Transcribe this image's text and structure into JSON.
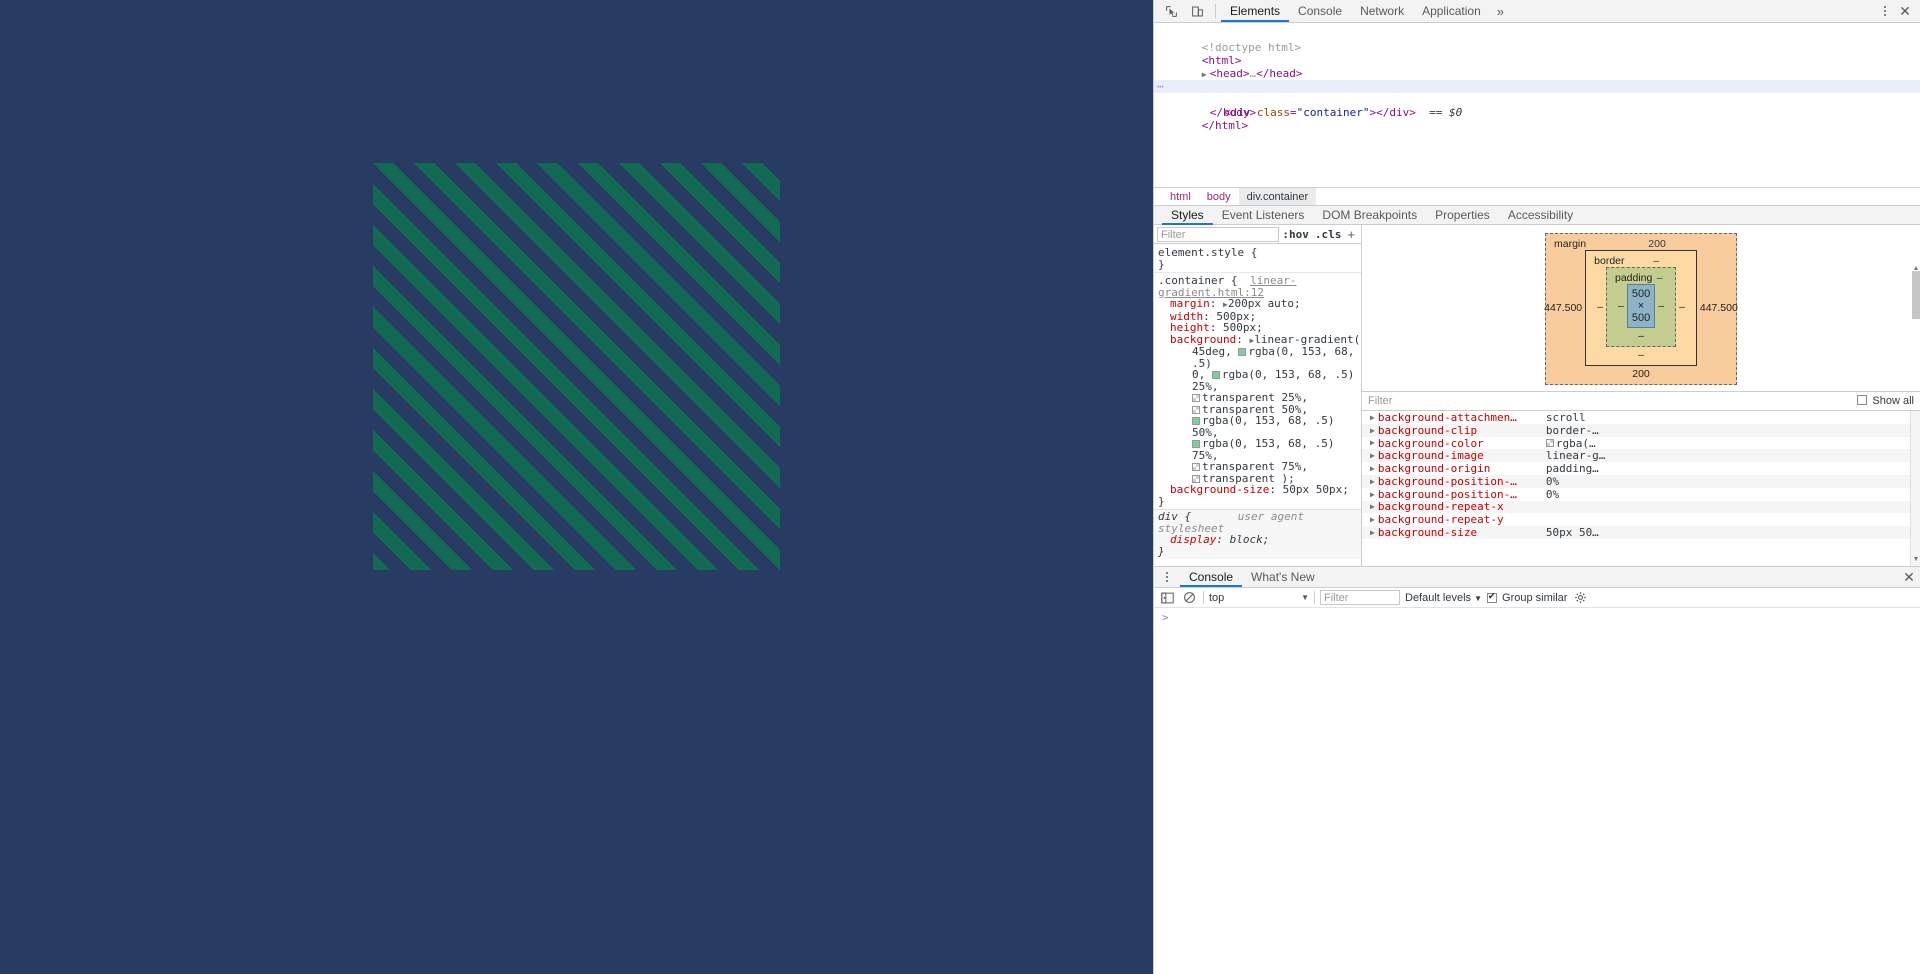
{
  "page": {
    "background_color": "#273b63",
    "box": {
      "name": "container-striped-box",
      "stripe_color": "rgba(0, 153, 68, .5)",
      "angle": "45deg",
      "tile": "50px 50px",
      "size": "500 x 500"
    }
  },
  "devtools": {
    "toolbar": {
      "inspect_icon": "inspect-cursor-icon",
      "device_icon": "device-toolbar-icon",
      "tabs": [
        {
          "label": "Elements",
          "active": true
        },
        {
          "label": "Console",
          "active": false
        },
        {
          "label": "Network",
          "active": false
        },
        {
          "label": "Application",
          "active": false
        }
      ],
      "more_tabs": "»",
      "menu_icon": "kebab-menu-icon",
      "close_icon": "close-icon"
    },
    "dom": {
      "lines": [
        {
          "indent": 0,
          "tokens": [
            {
              "t": "cmt",
              "v": "<!doctype html>"
            }
          ]
        },
        {
          "indent": 0,
          "tokens": [
            {
              "t": "tg",
              "v": "<html>"
            }
          ]
        },
        {
          "indent": 0,
          "caret": "▶",
          "tokens": [
            {
              "t": "tg",
              "v": "<head>"
            },
            {
              "t": "cmt",
              "v": "…"
            },
            {
              "t": "tg",
              "v": "</head>"
            }
          ]
        },
        {
          "indent": 0,
          "caret": "▼",
          "tokens": [
            {
              "t": "tg",
              "v": "<body>"
            }
          ]
        },
        {
          "indent": 1,
          "selected": true,
          "ellipsis": "⋯",
          "tokens": [
            {
              "t": "tg",
              "v": "<div "
            },
            {
              "t": "attr",
              "v": "class"
            },
            {
              "t": "tg",
              "v": "="
            },
            {
              "t": "val",
              "v": "\"container\""
            },
            {
              "t": "tg",
              "v": "></div>"
            },
            {
              "t": "dollar",
              "v": "  == $0"
            }
          ]
        },
        {
          "indent": 0,
          "tokens": [
            {
              "t": "tg",
              "v": "</body>"
            }
          ]
        },
        {
          "indent": 0,
          "tokens": [
            {
              "t": "tg",
              "v": "</html>"
            }
          ]
        }
      ]
    },
    "breadcrumb": [
      {
        "label": "html",
        "selected": false
      },
      {
        "label": "body",
        "selected": false
      },
      {
        "label": "div.container",
        "selected": true
      }
    ],
    "sidebar_tabs": [
      {
        "label": "Styles",
        "active": true
      },
      {
        "label": "Event Listeners",
        "active": false
      },
      {
        "label": "DOM Breakpoints",
        "active": false
      },
      {
        "label": "Properties",
        "active": false
      },
      {
        "label": "Accessibility",
        "active": false
      }
    ],
    "styles": {
      "filter_placeholder": "Filter",
      "hov_label": ":hov",
      "cls_label": ".cls",
      "plus_label": "+",
      "rules": [
        {
          "selector": "element.style {",
          "origin": "",
          "declarations": [],
          "close": "}"
        },
        {
          "selector": ".container {",
          "origin": "linear-gradient.html:12",
          "declarations": [
            {
              "tri": true,
              "name": "margin",
              "value": "200px auto;"
            },
            {
              "tri": false,
              "name": "width",
              "value": "500px;"
            },
            {
              "tri": false,
              "name": "height",
              "value": "500px;"
            },
            {
              "tri": true,
              "name": "background",
              "value": "linear-gradient("
            },
            {
              "cont": true,
              "swatch": "green",
              "value": "45deg, ",
              "value2": "rgba(0, 153, 68, .5)"
            },
            {
              "cont": true,
              "swatch": "green",
              "value": "0, ",
              "value2": "rgba(0, 153, 68, .5) 25%,"
            },
            {
              "cont": true,
              "swatch": "trans",
              "value": "",
              "value2": "transparent 25%,"
            },
            {
              "cont": true,
              "swatch": "trans",
              "value": "",
              "value2": "transparent 50%,"
            },
            {
              "cont": true,
              "swatch": "green",
              "value": "",
              "value2": "rgba(0, 153, 68, .5) 50%,"
            },
            {
              "cont": true,
              "swatch": "green",
              "value": "",
              "value2": "rgba(0, 153, 68, .5) 75%,"
            },
            {
              "cont": true,
              "swatch": "trans",
              "value": "",
              "value2": "transparent 75%,"
            },
            {
              "cont": true,
              "swatch": "trans",
              "value": "",
              "value2": "transparent );"
            },
            {
              "tri": false,
              "name": "background-size",
              "value": "50px 50px;"
            }
          ],
          "close": "}"
        },
        {
          "selector": "div {",
          "origin": "user agent stylesheet",
          "ua": true,
          "declarations": [
            {
              "tri": false,
              "name": "display",
              "value": "block;"
            }
          ],
          "close": "}"
        }
      ]
    },
    "box_model": {
      "margin_label": "margin",
      "margin_top": "200",
      "margin_bottom": "200",
      "margin_left": "447.500",
      "margin_right": "447.500",
      "border_label": "border",
      "border_top": "–",
      "border_left": "–",
      "border_right": "–",
      "border_bottom": "–",
      "padding_label": "padding",
      "padding_top": "–",
      "padding_left": "–",
      "padding_right": "–",
      "padding_bottom": "–",
      "content": "500 × 500"
    },
    "computed": {
      "filter_placeholder": "Filter",
      "show_all_label": "Show all",
      "show_all_checked": false,
      "properties": [
        {
          "name": "background-attachmen…",
          "value": "scroll",
          "swatch": false
        },
        {
          "name": "background-clip",
          "value": "border-…",
          "swatch": false
        },
        {
          "name": "background-color",
          "value": "rgba(…",
          "swatch": true
        },
        {
          "name": "background-image",
          "value": "linear-g…",
          "swatch": false
        },
        {
          "name": "background-origin",
          "value": "padding…",
          "swatch": false
        },
        {
          "name": "background-position-…",
          "value": "0%",
          "swatch": false
        },
        {
          "name": "background-position-…",
          "value": "0%",
          "swatch": false
        },
        {
          "name": "background-repeat-x",
          "value": "",
          "swatch": false
        },
        {
          "name": "background-repeat-y",
          "value": "",
          "swatch": false
        },
        {
          "name": "background-size",
          "value": "50px 50…",
          "swatch": false
        }
      ]
    },
    "drawer": {
      "menu_icon": "drawer-menu-icon",
      "tabs": [
        {
          "label": "Console",
          "active": true
        },
        {
          "label": "What's New",
          "active": false
        }
      ],
      "close_icon": "close-icon",
      "console_toolbar": {
        "sidebar_icon": "console-sidebar-icon",
        "clear_icon": "clear-console-icon",
        "context": "top",
        "filter_placeholder": "Filter",
        "levels_label": "Default levels",
        "group_similar_label": "Group similar",
        "group_similar_checked": true,
        "settings_icon": "gear-icon"
      },
      "prompt": ">"
    }
  }
}
